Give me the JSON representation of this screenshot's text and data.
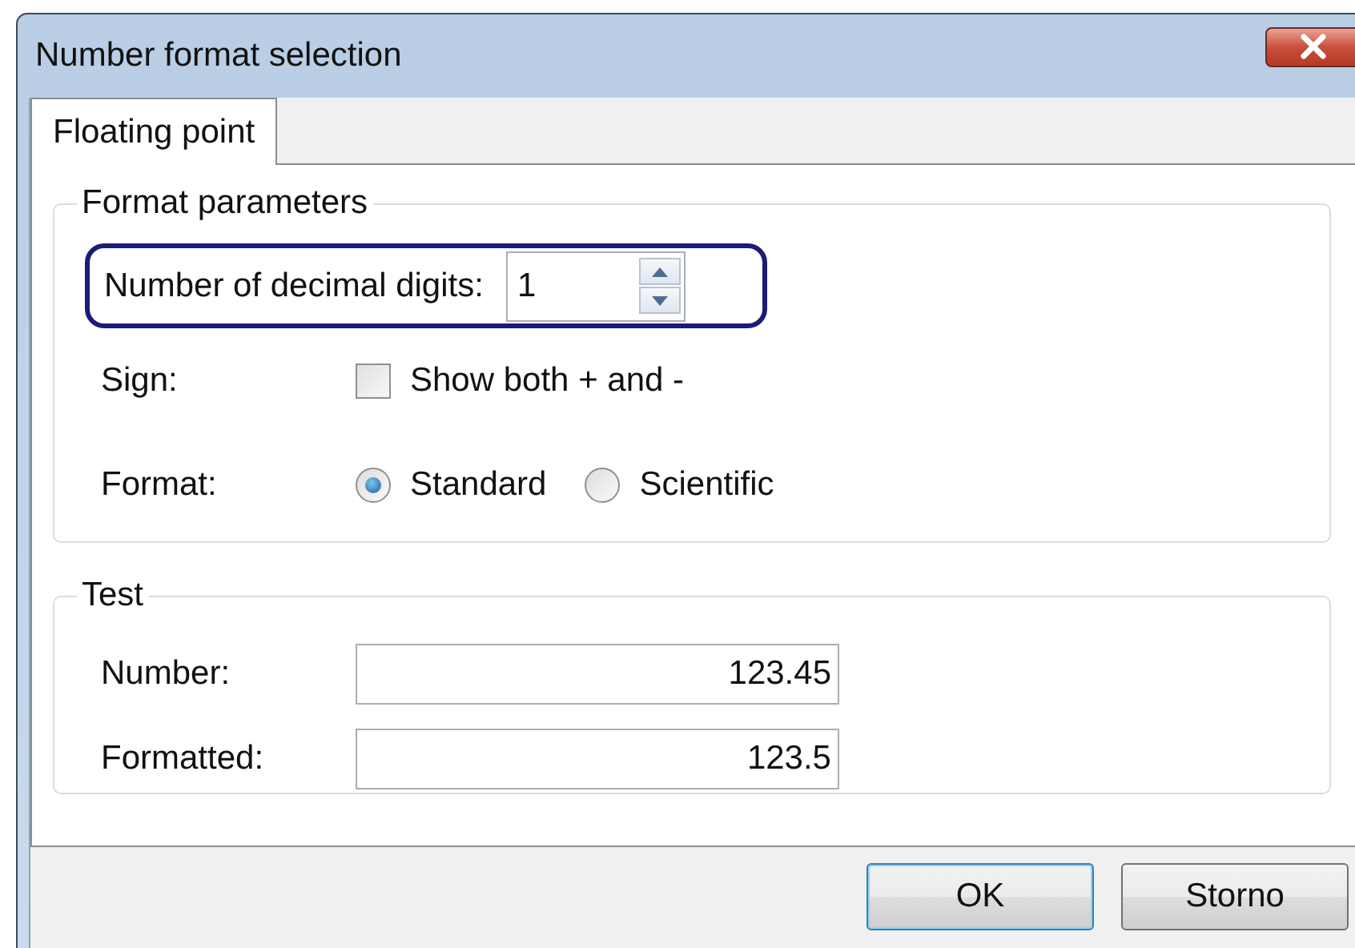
{
  "window": {
    "title": "Number format selection"
  },
  "tabs": [
    {
      "label": "Floating point",
      "selected": true
    }
  ],
  "format_parameters": {
    "title": "Format parameters",
    "decimal_digits": {
      "label": "Number of decimal digits:",
      "value": "1",
      "highlighted": true
    },
    "sign": {
      "label": "Sign:",
      "checkbox": {
        "label": "Show both + and -",
        "checked": false
      }
    },
    "format": {
      "label": "Format:",
      "options": [
        {
          "label": "Standard",
          "selected": true
        },
        {
          "label": "Scientific",
          "selected": false
        }
      ]
    }
  },
  "test": {
    "title": "Test",
    "fields": [
      {
        "label": "Number:",
        "value": "123.45"
      },
      {
        "label": "Formatted:",
        "value": "123.5"
      }
    ]
  },
  "buttons": [
    {
      "label": "OK",
      "default": true
    },
    {
      "label": "Storno",
      "default": false
    }
  ]
}
